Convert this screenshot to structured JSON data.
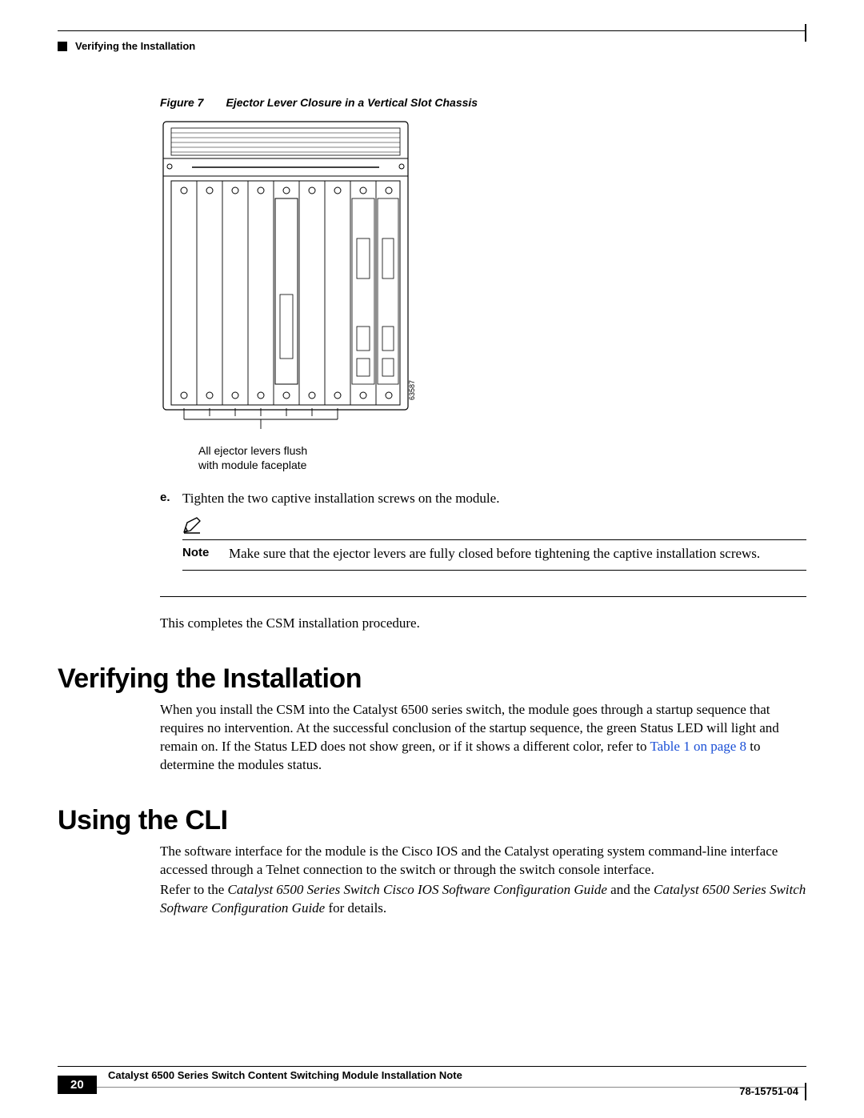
{
  "header": {
    "running_title": "Verifying the Installation"
  },
  "figure": {
    "label": "Figure 7",
    "title": "Ejector Lever Closure in a Vertical Slot Chassis",
    "callout_line1": "All ejector levers flush",
    "callout_line2": "with module faceplate",
    "art_id": "63587"
  },
  "step": {
    "letter": "e.",
    "text": "Tighten the two captive installation screws on the module."
  },
  "note": {
    "label": "Note",
    "text": "Make sure that the ejector levers are fully closed before tightening the captive installation screws."
  },
  "completion_text": "This completes the CSM installation procedure.",
  "section1": {
    "heading": "Verifying the Installation",
    "para_before_link": "When you install the CSM into the Catalyst 6500 series switch, the module goes through a startup sequence that requires no intervention. At the successful conclusion of the startup sequence, the green Status LED will light and remain on. If the Status LED does not show green, or if it shows a different color, refer to ",
    "link_text": "Table 1 on page 8",
    "para_after_link": " to determine the modules status."
  },
  "section2": {
    "heading": "Using the CLI",
    "para1": "The software interface for the module is the Cisco IOS and the Catalyst operating system command-line interface accessed through a Telnet connection to the switch or through the switch console interface.",
    "para2_lead": "Refer to the ",
    "para2_italic1": "Catalyst 6500 Series Switch Cisco IOS Software Configuration Guide",
    "para2_mid": " and the ",
    "para2_italic2": "Catalyst 6500 Series Switch Software Configuration Guide",
    "para2_tail": " for details."
  },
  "footer": {
    "doc_title": "Catalyst 6500 Series Switch Content Switching Module Installation Note",
    "page_number": "20",
    "doc_id": "78-15751-04"
  }
}
